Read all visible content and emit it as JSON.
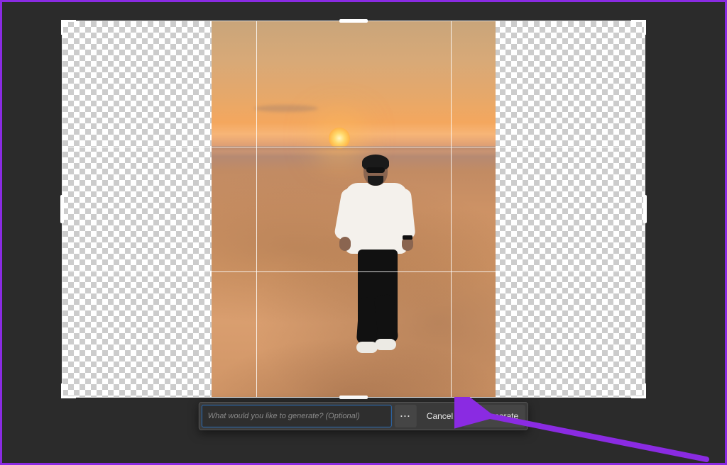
{
  "toolbar": {
    "prompt_placeholder": "What would you like to generate? (Optional)",
    "prompt_value": "",
    "more_label": "···",
    "cancel_label": "Cancel",
    "generate_label": "Generate"
  },
  "annotation": {
    "highlight_color": "#8A2BE2"
  }
}
